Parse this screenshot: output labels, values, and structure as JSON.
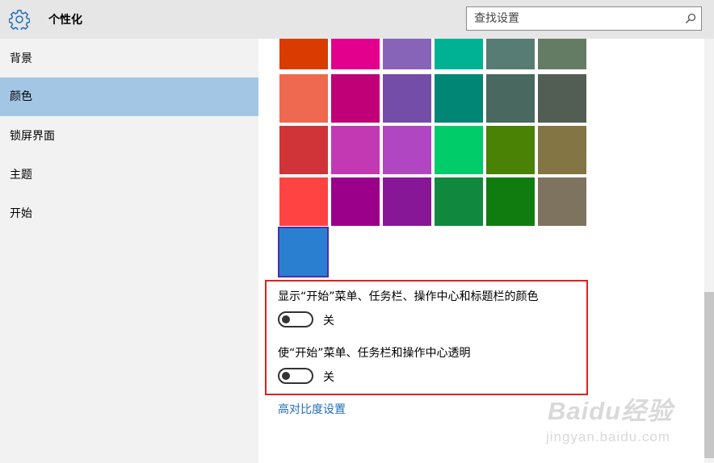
{
  "header": {
    "title": "个性化",
    "search_placeholder": "查找设置"
  },
  "sidebar": {
    "items": [
      {
        "label": "背景",
        "active": false
      },
      {
        "label": "颜色",
        "active": true
      },
      {
        "label": "锁屏界面",
        "active": false
      },
      {
        "label": "主题",
        "active": false
      },
      {
        "label": "开始",
        "active": false
      }
    ]
  },
  "colors": {
    "selected": "#2b7fd1",
    "rows": [
      [
        "#da3b01",
        "#e3008c",
        "#8764b8",
        "#00b294",
        "#567c73",
        "#647c64"
      ],
      [
        "#ef6950",
        "#bf0077",
        "#744da9",
        "#018574",
        "#486860",
        "#525e54"
      ],
      [
        "#d13438",
        "#c239b3",
        "#b146c2",
        "#00cc6a",
        "#498205",
        "#847545"
      ],
      [
        "#ff4343",
        "#9a0089",
        "#881798",
        "#10893e",
        "#107c10",
        "#7e735f"
      ],
      [
        "#2b7fd1"
      ]
    ]
  },
  "settings": {
    "accent_on_surfaces": {
      "label": "显示“开始”菜单、任务栏、操作中心和标题栏的颜色",
      "state": "关",
      "on": false
    },
    "transparency": {
      "label": "使“开始”菜单、任务栏和操作中心透明",
      "state": "关",
      "on": false
    }
  },
  "links": {
    "high_contrast": "高对比度设置"
  },
  "watermark": {
    "brand": "Baidu经验",
    "sub": "jingyan.baidu.com"
  }
}
